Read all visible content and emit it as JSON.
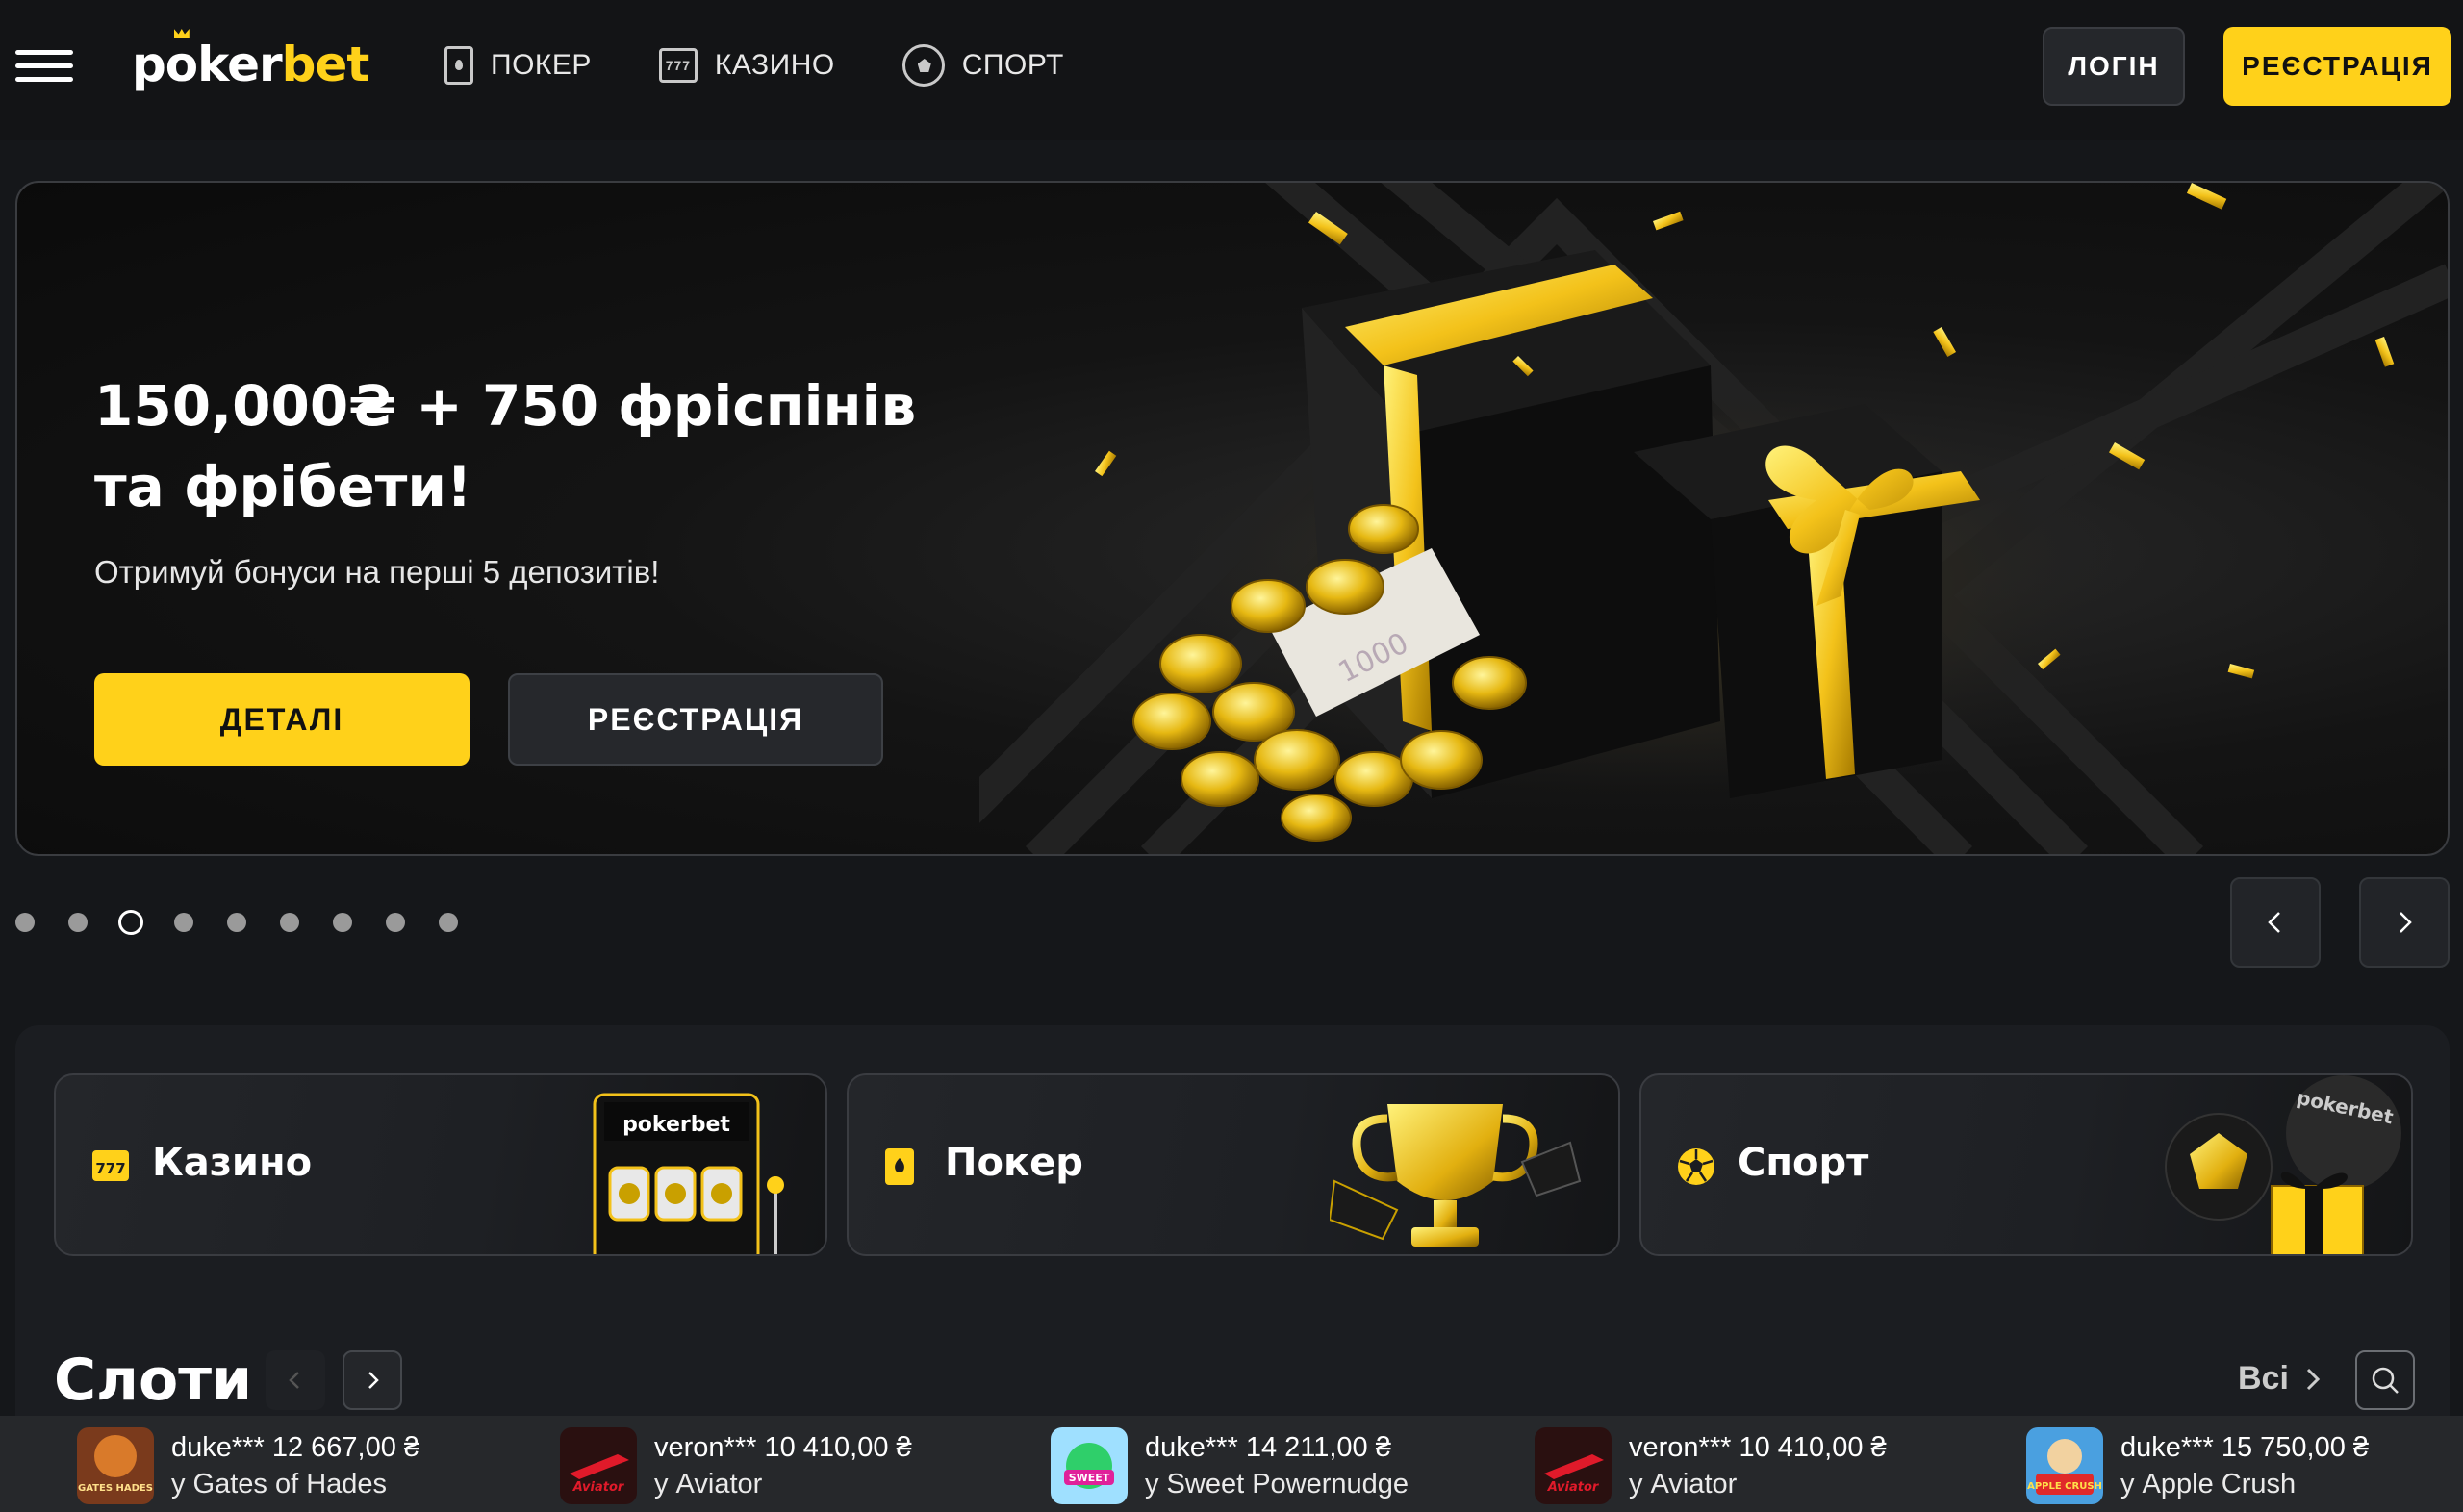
{
  "header": {
    "logo_part1": "p",
    "logo_part2": "ker",
    "logo_part3": "bet",
    "nav": [
      {
        "label": "ПОКЕР",
        "icon": "poker-card-icon"
      },
      {
        "label": "КАЗИНО",
        "icon": "slot-machine-icon"
      },
      {
        "label": "СПОРТ",
        "icon": "soccer-ball-icon"
      }
    ],
    "login_label": "ЛОГІН",
    "register_label": "РЕЄСТРАЦІЯ"
  },
  "hero": {
    "title": "150,000₴ + 750 фріспінів та фрібети!",
    "subtitle": "Отримуй бонуси на перші 5 депозитів!",
    "details_label": "ДЕТАЛІ",
    "register_label": "РЕЄСТРАЦІЯ",
    "slide_count": 9,
    "active_slide": 3
  },
  "categories": [
    {
      "label": "Казино",
      "icon": "slot-machine-icon",
      "art_text": "pokerbet"
    },
    {
      "label": "Покер",
      "icon": "poker-card-icon"
    },
    {
      "label": "Спорт",
      "icon": "soccer-ball-icon",
      "art_text": "pokerbet"
    }
  ],
  "slots": {
    "title": "Слоти",
    "all_label": "Всі"
  },
  "winners": [
    {
      "user": "duke***",
      "amount": "12 667,00 ₴",
      "game": "у Gates of Hades",
      "thumb_text": "GATES HADES"
    },
    {
      "user": "veron***",
      "amount": "10 410,00 ₴",
      "game": "у Aviator",
      "thumb_text": "Aviator"
    },
    {
      "user": "duke***",
      "amount": "14 211,00 ₴",
      "game": "у Sweet Powernudge",
      "thumb_text": "SWEET"
    },
    {
      "user": "veron***",
      "amount": "10 410,00 ₴",
      "game": "у Aviator",
      "thumb_text": "Aviator"
    },
    {
      "user": "duke***",
      "amount": "15 750,00 ₴",
      "game": "у Apple Crush",
      "thumb_text": "APPLE CRUSH"
    }
  ],
  "colors": {
    "accent": "#ffd11a",
    "background": "#15171a",
    "panel": "#1b1d21"
  }
}
